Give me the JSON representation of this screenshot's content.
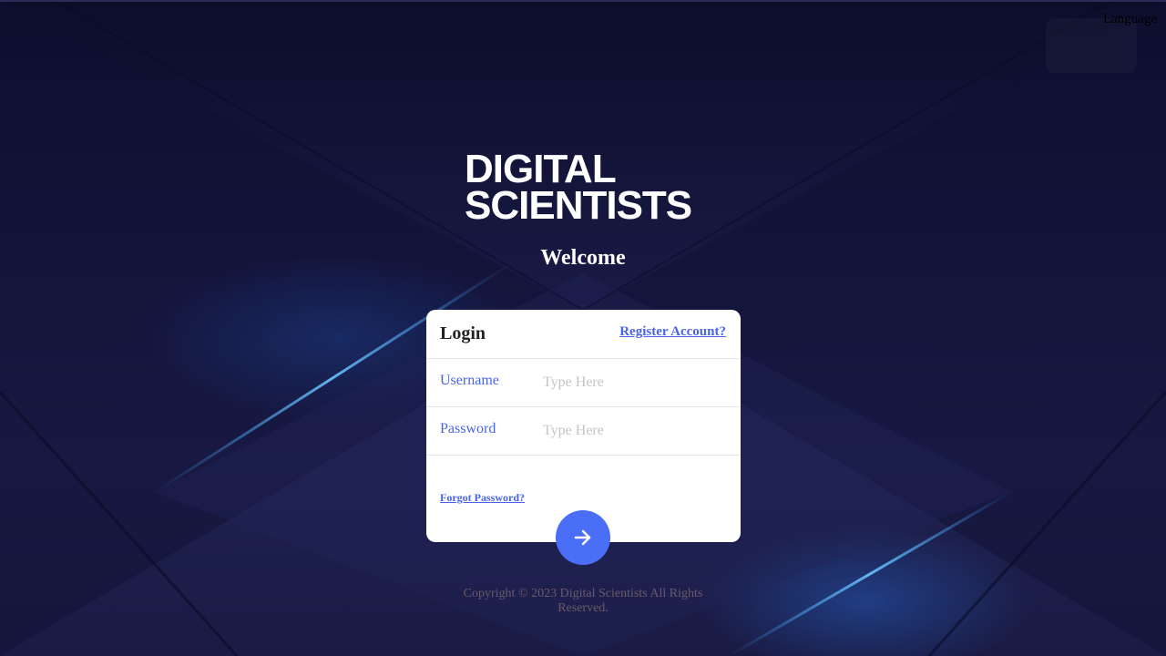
{
  "header": {
    "language_label": "Language"
  },
  "brand": {
    "line1": "DIGITAL",
    "line2": "SCIENTISTS"
  },
  "welcome": "Welcome",
  "login_card": {
    "title": "Login",
    "register_link": "Register Account?",
    "username": {
      "label": "Username",
      "placeholder": "Type Here",
      "value": ""
    },
    "password": {
      "label": "Password",
      "placeholder": "Type Here",
      "value": ""
    },
    "forgot_link": "Forgot Password?",
    "submit_icon": "arrow-right-icon"
  },
  "footer": {
    "copyright": "Copyright © 2023 Digital Scientists All Rights Reserved."
  },
  "colors": {
    "accent": "#4a63e6",
    "submit_button": "#4b6ef6",
    "background": "#15173c",
    "card": "#ffffff"
  }
}
